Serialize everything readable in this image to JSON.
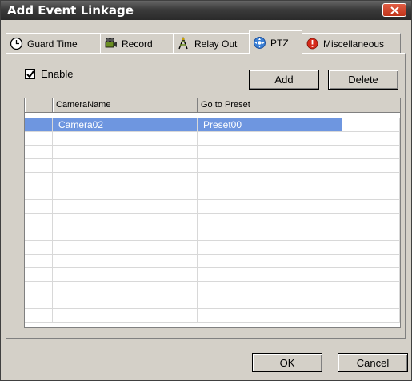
{
  "window": {
    "title": "Add Event Linkage"
  },
  "tabs": [
    {
      "label": "Guard Time",
      "icon": "clock-icon"
    },
    {
      "label": "Record",
      "icon": "camera-icon"
    },
    {
      "label": "Relay Out",
      "icon": "relay-icon"
    },
    {
      "label": "PTZ",
      "icon": "ptz-icon",
      "active": true
    },
    {
      "label": "Miscellaneous",
      "icon": "alert-icon"
    }
  ],
  "ptz": {
    "enable_label": "Enable",
    "enable_checked": true,
    "add_label": "Add",
    "delete_label": "Delete",
    "columns": [
      "CameraName",
      "Go to Preset"
    ],
    "rows": [
      {
        "camera": "Camera02",
        "preset": "Preset00",
        "selected": true
      }
    ]
  },
  "footer": {
    "ok_label": "OK",
    "cancel_label": "Cancel"
  },
  "colors": {
    "selection": "#6e96e0",
    "titlebar": "#3b3b3b",
    "close": "#c0341a"
  }
}
